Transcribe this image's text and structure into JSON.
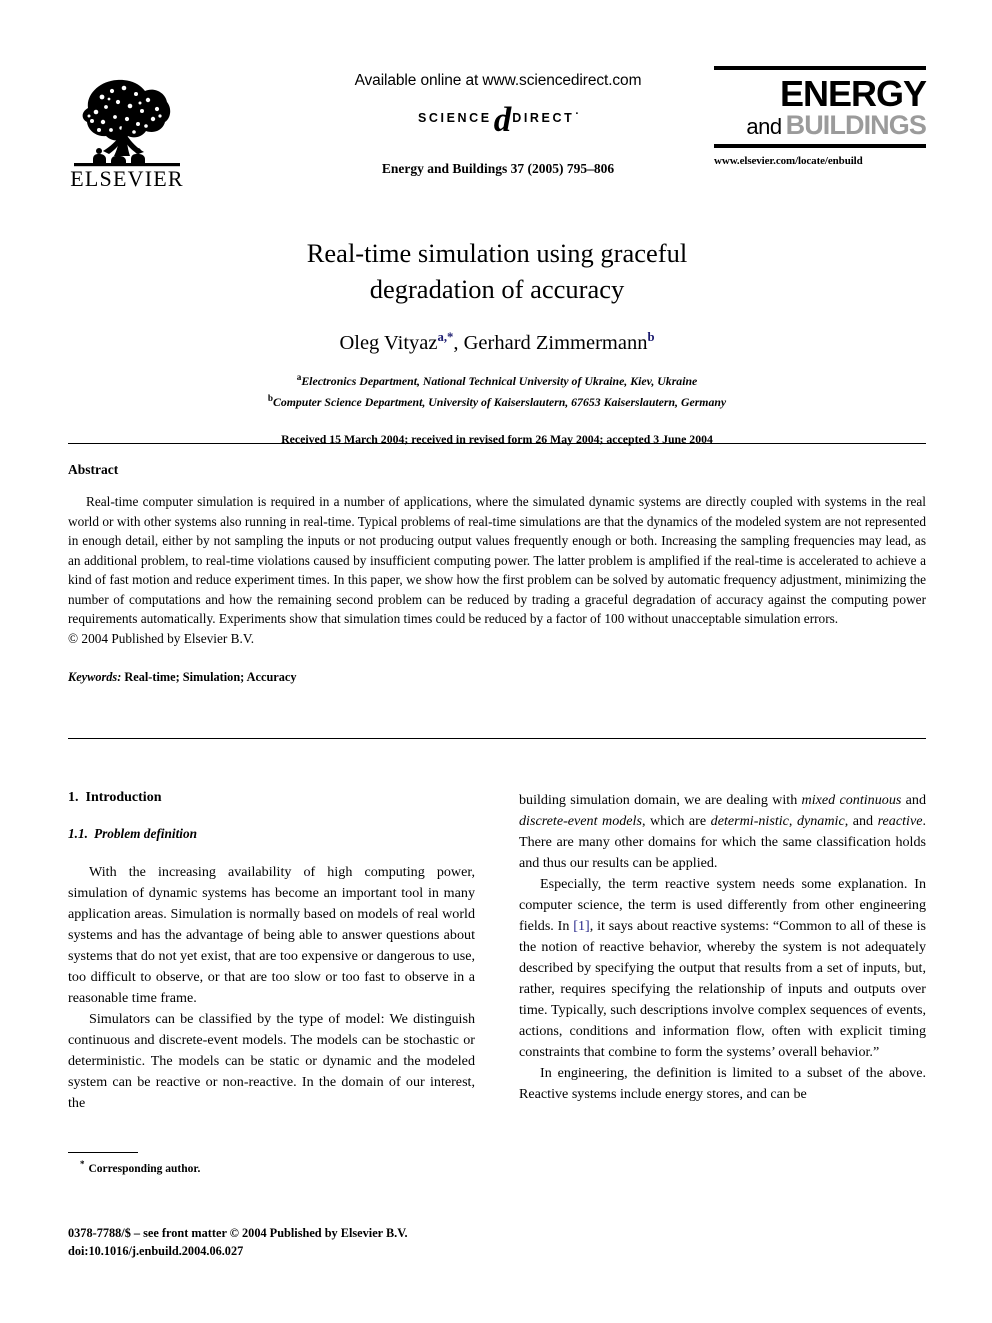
{
  "masthead": {
    "elsevier_wordmark": "ELSEVIER",
    "available_online": "Available online at www.sciencedirect.com",
    "sciencedirect": {
      "science": "SCIENCE",
      "d_glyph": "d",
      "direct": "DIRECT",
      "trademark_dot": "·"
    },
    "journal_ref": "Energy and Buildings 37 (2005) 795–806",
    "journal_logo": {
      "energy": "ENERGY",
      "and": "and",
      "buildings": "BUILDINGS",
      "energy_color": "#000000",
      "buildings_color": "#9b9b9b"
    },
    "journal_url": "www.elsevier.com/locate/enbuild"
  },
  "title": "Real-time simulation using graceful degradation of accuracy",
  "authors": {
    "first_name": "Oleg Vityaz",
    "first_sup": "a,*",
    "separator": ", ",
    "second_name": "Gerhard Zimmermann",
    "second_sup": "b",
    "sup_color": "#1b1b6f"
  },
  "affiliations": [
    {
      "mark": "a",
      "text": "Electronics Department, National Technical University of Ukraine, Kiev, Ukraine"
    },
    {
      "mark": "b",
      "text": "Computer Science Department, University of Kaiserslautern, 67653 Kaiserslautern, Germany"
    }
  ],
  "dates": "Received 15 March 2004; received in revised form 26 May 2004; accepted 3 June 2004",
  "abstract": {
    "heading": "Abstract",
    "body": "Real-time computer simulation is required in a number of applications, where the simulated dynamic systems are directly coupled with systems in the real world or with other systems also running in real-time. Typical problems of real-time simulations are that the dynamics of the modeled system are not represented in enough detail, either by not sampling the inputs or not producing output values frequently enough or both. Increasing the sampling frequencies may lead, as an additional problem, to real-time violations caused by insufficient computing power. The latter problem is amplified if the real-time is accelerated to achieve a kind of fast motion and reduce experiment times. In this paper, we show how the first problem can be solved by automatic frequency adjustment, minimizing the number of computations and how the remaining second problem can be reduced by trading a graceful degradation of accuracy against the computing power requirements automatically. Experiments show that simulation times could be reduced by a factor of 100 without unacceptable simulation errors.",
    "copyright": "© 2004 Published by Elsevier B.V."
  },
  "keywords": {
    "label": "Keywords:",
    "values": "Real-time; Simulation; Accuracy"
  },
  "sections": {
    "intro_number": "1.",
    "intro_title": "Introduction",
    "subsection_number": "1.1.",
    "subsection_title": "Problem definition"
  },
  "body": {
    "left": [
      "With the increasing availability of high computing power, simulation of dynamic systems has become an important tool in many application areas. Simulation is normally based on models of real world systems and has the advantage of being able to answer questions about systems that do not yet exist, that are too expensive or dangerous to use, too difficult to observe, or that are too slow or too fast to observe in a reasonable time frame.",
      "Simulators can be classified by the type of model: We distinguish continuous and discrete-event models. The models can be stochastic or deterministic. The models can be static or dynamic and the modeled system can be reactive or non-reactive. In the domain of our interest, the"
    ],
    "right_para1": {
      "p1": "building simulation domain, we are dealing with ",
      "i1": "mixed continuous",
      "p2": " and ",
      "i2": "discrete-event models",
      "p3": ", which are ",
      "i3": "determi-nistic",
      "p4": ", ",
      "i4": "dynamic",
      "p5": ", and ",
      "i5": "reactive",
      "p6": ". There are many other domains for which the same classification holds and thus our results can be applied."
    },
    "right_para2": {
      "before_ref": "Especially, the term reactive system needs some explanation. In computer science, the term is used differently from other engineering fields. In ",
      "ref": "[1]",
      "after_ref": ", it says about reactive systems: “Common to all of these is the notion of reactive behavior, whereby the system is not adequately described by specifying the output that results from a set of inputs, but, rather, requires specifying the relationship of inputs and outputs over time. Typically, such descriptions involve complex sequences of events, actions, conditions and information flow, often with explicit timing constraints that combine to form the systems’ overall behavior.”",
      "ref_color": "#2a2a8c"
    },
    "right_para3": "In engineering, the definition is limited to a subset of the above. Reactive systems include energy stores, and can be"
  },
  "footnote": {
    "star": "*",
    "text": "Corresponding author."
  },
  "footer": {
    "line1": "0378-7788/$ – see front matter © 2004 Published by Elsevier B.V.",
    "line2": "doi:10.1016/j.enbuild.2004.06.027"
  }
}
